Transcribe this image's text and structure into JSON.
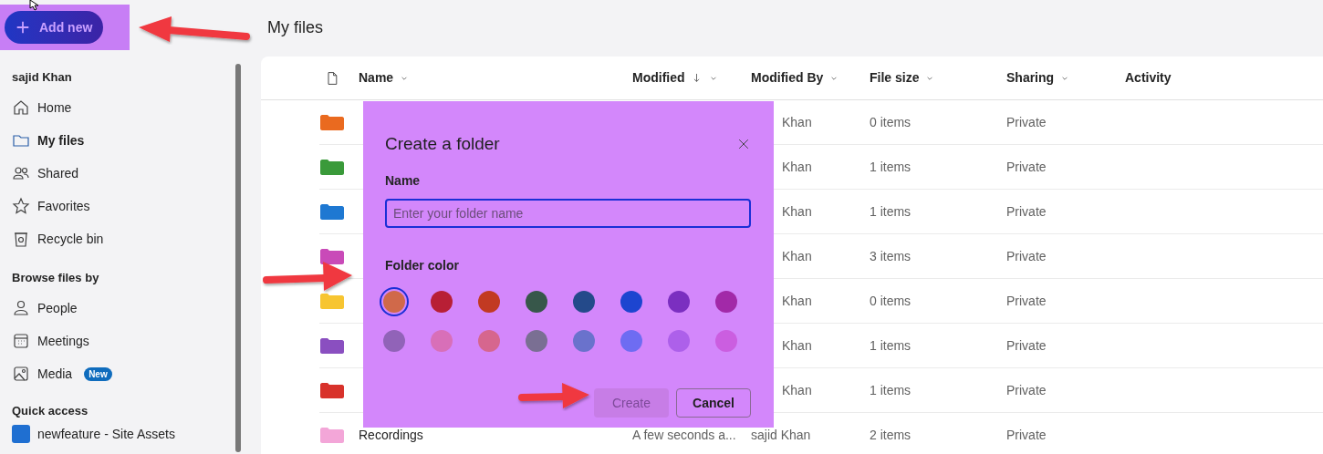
{
  "add_button": {
    "label": "Add new"
  },
  "sidebar": {
    "user": "sajid Khan",
    "items": [
      {
        "label": "Home",
        "kind": "home",
        "selected": false
      },
      {
        "label": "My files",
        "kind": "folder",
        "selected": true
      },
      {
        "label": "Shared",
        "kind": "people",
        "selected": false
      },
      {
        "label": "Favorites",
        "kind": "star",
        "selected": false
      },
      {
        "label": "Recycle bin",
        "kind": "bin",
        "selected": false
      }
    ],
    "browse_heading": "Browse files by",
    "browse_items": [
      {
        "label": "People",
        "kind": "person"
      },
      {
        "label": "Meetings",
        "kind": "calendar"
      },
      {
        "label": "Media",
        "kind": "image",
        "badge": "New"
      }
    ],
    "quick_heading": "Quick access",
    "quick_items": [
      {
        "label": "newfeature - Site Assets"
      }
    ]
  },
  "page_title": "My files",
  "table": {
    "columns": [
      {
        "label": "Name",
        "sorted": false,
        "menu": true
      },
      {
        "label": "Modified",
        "sorted": true,
        "menu": true
      },
      {
        "label": "Modified By",
        "sorted": false,
        "menu": true
      },
      {
        "label": "File size",
        "sorted": false,
        "menu": true
      },
      {
        "label": "Sharing",
        "sorted": false,
        "menu": true
      },
      {
        "label": "Activity",
        "sorted": false,
        "menu": false
      }
    ],
    "rows": [
      {
        "color": "#ea6a1f",
        "modified_by": "Khan",
        "size": "0 items",
        "sharing": "Private"
      },
      {
        "color": "#3a9a3a",
        "modified_by": "Khan",
        "size": "1 items",
        "sharing": "Private"
      },
      {
        "color": "#1e78d2",
        "modified_by": "Khan",
        "size": "1 items",
        "sharing": "Private"
      },
      {
        "color": "#c94ab8",
        "modified_by": "Khan",
        "size": "3 items",
        "sharing": "Private"
      },
      {
        "color": "#f7c531",
        "modified_by": "Khan",
        "size": "0 items",
        "sharing": "Private"
      },
      {
        "color": "#8a4fc0",
        "modified_by": "Khan",
        "size": "1 items",
        "sharing": "Private"
      },
      {
        "color": "#d8322b",
        "modified_by": "Khan",
        "size": "1 items",
        "sharing": "Private"
      },
      {
        "color": "#f3a6d8",
        "name": "Recordings",
        "modified": "A few seconds a...",
        "modified_by": "sajid Khan",
        "size": "2 items",
        "sharing": "Private"
      }
    ]
  },
  "dialog": {
    "title": "Create a folder",
    "name_label": "Name",
    "placeholder": "Enter your folder name",
    "color_label": "Folder color",
    "colors": [
      {
        "color": "#d0694a",
        "selected": true
      },
      {
        "color": "#b81f35",
        "selected": false
      },
      {
        "color": "#c23a22",
        "selected": false
      },
      {
        "color": "#37574a",
        "selected": false
      },
      {
        "color": "#244a8a",
        "selected": false
      },
      {
        "color": "#1d45d0",
        "selected": false
      },
      {
        "color": "#7b2fc0",
        "selected": false
      },
      {
        "color": "#a229a8",
        "selected": false
      },
      {
        "color": "#9163b8",
        "selected": false
      },
      {
        "color": "#d86fb8",
        "selected": false
      },
      {
        "color": "#d6668e",
        "selected": false
      },
      {
        "color": "#7a6f93",
        "selected": false
      },
      {
        "color": "#6a72cc",
        "selected": false
      },
      {
        "color": "#6e6cf2",
        "selected": false
      },
      {
        "color": "#ad60ea",
        "selected": false
      },
      {
        "color": "#cb5ee0",
        "selected": false
      }
    ],
    "buttons": [
      {
        "label": "Create",
        "disabled": true
      },
      {
        "label": "Cancel",
        "disabled": false
      }
    ]
  }
}
